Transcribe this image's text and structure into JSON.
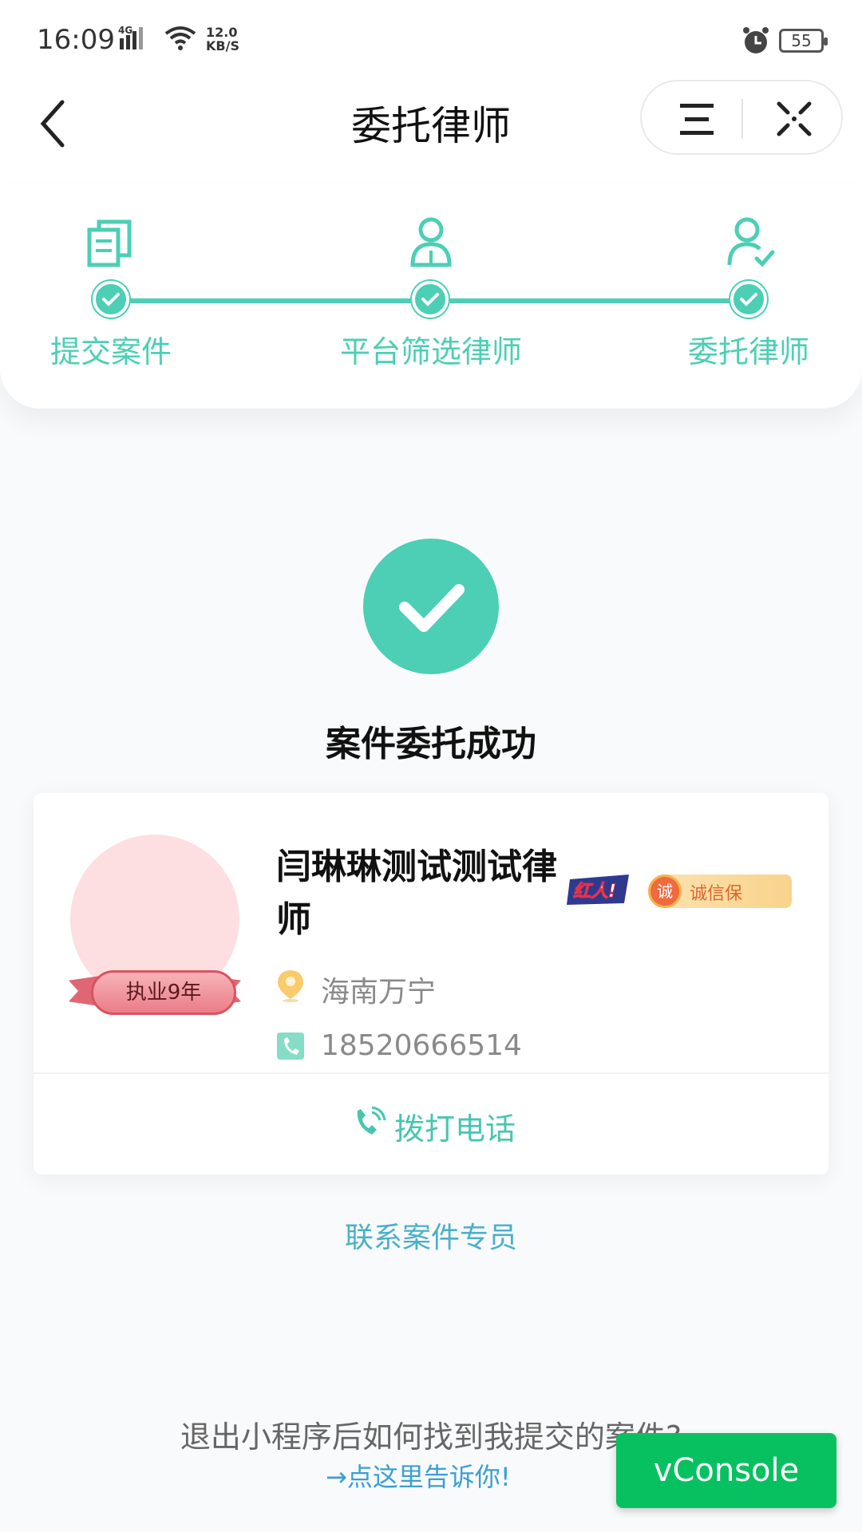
{
  "status_bar": {
    "time": "16:09",
    "network": "4G",
    "speed_value": "12.0",
    "speed_unit": "KB/S",
    "battery": "55"
  },
  "nav": {
    "title": "委托律师"
  },
  "steps": [
    {
      "label": "提交案件",
      "icon": "documents-icon",
      "done": true
    },
    {
      "label": "平台筛选律师",
      "icon": "user-icon",
      "done": true
    },
    {
      "label": "委托律师",
      "icon": "user-check-icon",
      "done": true
    }
  ],
  "result": {
    "title": "案件委托成功"
  },
  "lawyer": {
    "name": "闫琳琳测试测试律师",
    "experience": "执业9年",
    "badge_hongren": "红人!",
    "badge_chengxin_icon": "诚",
    "badge_chengxin": "诚信保",
    "location": "海南万宁",
    "phone": "18520666514",
    "call_label": "拨打电话"
  },
  "contact_link": "联系案件专员",
  "footer": {
    "question": "退出小程序后如何找到我提交的案件?",
    "link": "→点这里告诉你!"
  },
  "vconsole_label": "vConsole",
  "colors": {
    "accent": "#4ccfb4",
    "link": "#4ab0c8",
    "vconsole": "#07c160"
  }
}
